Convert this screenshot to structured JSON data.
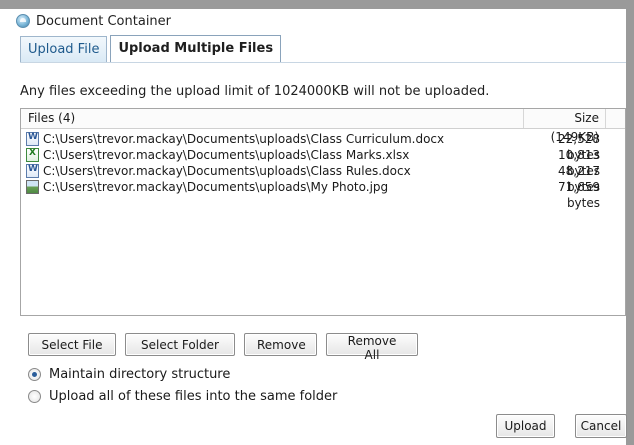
{
  "window": {
    "title": "Document Container",
    "title_icon": "globe-icon"
  },
  "tabs": [
    {
      "label": "Upload File",
      "active": false
    },
    {
      "label": "Upload Multiple Files",
      "active": true
    }
  ],
  "limit_note": "Any files exceeding the upload limit of 1024000KB will not be uploaded.",
  "file_list": {
    "header_files": "Files (4)",
    "header_size": "Size (149KB)",
    "rows": [
      {
        "icon": "word-doc-icon",
        "path": "C:\\Users\\trevor.mackay\\Documents\\uploads\\Class Curriculum.docx",
        "size": "22,528 bytes"
      },
      {
        "icon": "excel-sheet-icon",
        "path": "C:\\Users\\trevor.mackay\\Documents\\uploads\\Class Marks.xlsx",
        "size": "10,813 bytes"
      },
      {
        "icon": "word-doc-icon",
        "path": "C:\\Users\\trevor.mackay\\Documents\\uploads\\Class Rules.docx",
        "size": "48,217 bytes"
      },
      {
        "icon": "image-file-icon",
        "path": "C:\\Users\\trevor.mackay\\Documents\\uploads\\My Photo.jpg",
        "size": "71,659 bytes"
      }
    ]
  },
  "actions": {
    "select_file": "Select File",
    "select_folder": "Select Folder",
    "remove": "Remove",
    "remove_all": "Remove All"
  },
  "options": {
    "maintain_structure": "Maintain directory structure",
    "same_folder": "Upload all of these files into the same folder",
    "selected": "maintain_structure"
  },
  "footer": {
    "upload": "Upload",
    "cancel": "Cancel"
  }
}
